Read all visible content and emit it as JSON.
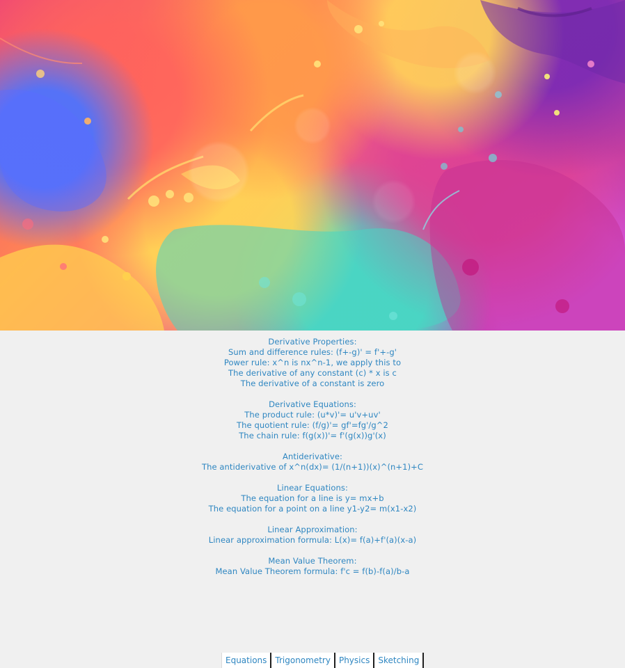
{
  "hero": {
    "image_name": "colorful-paint-splash-banner"
  },
  "sections": [
    {
      "title": "Derivative Properties:",
      "lines": [
        "Sum and difference rules: (f+-g)' = f'+-g'",
        "Power rule: x^n is nx^n-1, we apply this to",
        "The derivative of any constant (c) * x is c",
        "The derivative of a constant is zero"
      ]
    },
    {
      "title": "Derivative Equations:",
      "lines": [
        "The product rule: (u*v)'= u'v+uv'",
        "The quotient rule: (f/g)'= gf'=fg'/g^2",
        "The chain rule: f(g(x))'= f'(g(x))g'(x)"
      ]
    },
    {
      "title": "Antiderivative:",
      "lines": [
        "The antiderivative of x^n(dx)= (1/(n+1))(x)^(n+1)+C"
      ]
    },
    {
      "title": "Linear Equations:",
      "lines": [
        "The equation for a line is y= mx+b",
        "The equation for a point on a line y1-y2= m(x1-x2)"
      ]
    },
    {
      "title": "Linear Approximation:",
      "lines": [
        "Linear approximation formula: L(x)= f(a)+f'(a)(x-a)"
      ]
    },
    {
      "title": "Mean Value Theorem:",
      "lines": [
        "Mean Value Theorem formula: f'c = f(b)-f(a)/b-a"
      ]
    }
  ],
  "tabs": [
    {
      "label": "Equations"
    },
    {
      "label": "Trigonometry"
    },
    {
      "label": "Physics"
    },
    {
      "label": "Sketching"
    }
  ],
  "colors": {
    "text_accent": "#2e86c1",
    "background": "#f0f0f0",
    "tab_divider": "#1f1f1f"
  }
}
